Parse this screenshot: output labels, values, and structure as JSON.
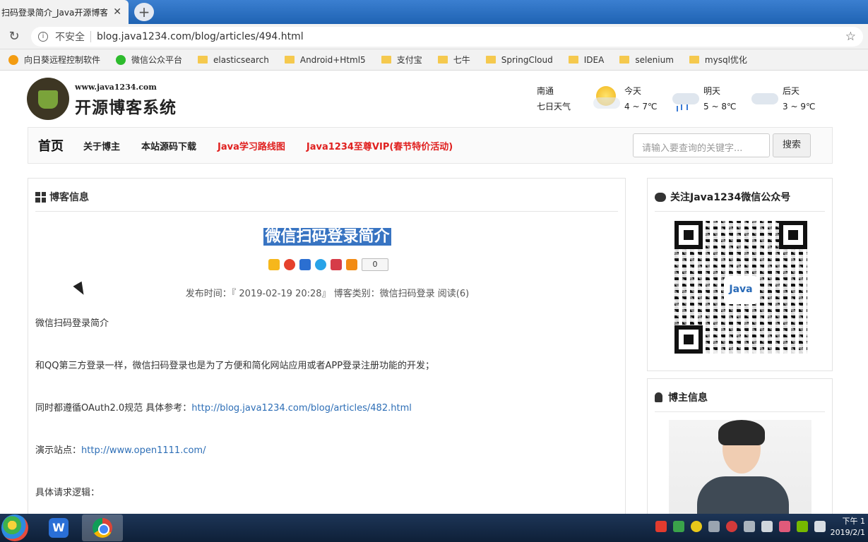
{
  "browser": {
    "tab_title": "扫码登录简介_Java开源博客",
    "tab_close": "✕",
    "new_tab": "+",
    "reload": "↻",
    "insecure_label": "不安全",
    "url": "blog.java1234.com/blog/articles/494.html",
    "star": "☆"
  },
  "bookmarks": [
    {
      "label": "向日葵远程控制软件",
      "icon": "sunflower-icon"
    },
    {
      "label": "微信公众平台",
      "icon": "wechat-icon"
    },
    {
      "label": "elasticsearch",
      "icon": "folder-icon"
    },
    {
      "label": "Android+Html5",
      "icon": "folder-icon"
    },
    {
      "label": "支付宝",
      "icon": "folder-icon"
    },
    {
      "label": "七牛",
      "icon": "folder-icon"
    },
    {
      "label": "SpringCloud",
      "icon": "folder-icon"
    },
    {
      "label": "IDEA",
      "icon": "folder-icon"
    },
    {
      "label": "selenium",
      "icon": "folder-icon"
    },
    {
      "label": "mysql优化",
      "icon": "folder-icon"
    }
  ],
  "site": {
    "logo_url": "www.java1234.com",
    "logo_name": "开源博客系统"
  },
  "weather": {
    "city": "南通",
    "subtitle": "七日天气",
    "days": [
      {
        "label": "今天",
        "temp": "4 ~ 7℃",
        "icon": "sunny-icon"
      },
      {
        "label": "明天",
        "temp": "5 ~ 8℃",
        "icon": "rain-icon"
      },
      {
        "label": "后天",
        "temp": "3 ~ 9℃",
        "icon": "cloudy-icon"
      }
    ]
  },
  "nav": {
    "home": "首页",
    "items": [
      "关于博主",
      "本站源码下载"
    ],
    "red_items": [
      "Java学习路线图",
      "Java1234至尊VIP(春节特价活动)"
    ],
    "search_placeholder": "请输入要查询的关键字...",
    "search_button": "搜索"
  },
  "article": {
    "panel_title": "博客信息",
    "title": "微信扫码登录简介",
    "share_count": "0",
    "meta": "发布时间：『 2019-02-19 20:28』  博客类别：微信扫码登录  阅读(6)",
    "p1": "微信扫码登录简介",
    "p2": "和QQ第三方登录一样，微信扫码登录也是为了方便和简化网站应用或者APP登录注册功能的开发；",
    "p3_text": "同时都遵循OAuth2.0规范 具体参考：",
    "p3_link": "http://blog.java1234.com/blog/articles/482.html",
    "p4_text": "演示站点：",
    "p4_link": "http://www.open1111.com/",
    "p5": "具体请求逻辑："
  },
  "sidebar": {
    "qr_title": "关注Java1234微信公众号",
    "qr_center": "Java",
    "author_title": "博主信息"
  },
  "taskbar": {
    "wps_label": "W",
    "clock_time": "下午 1",
    "clock_date": "2019/2/1"
  }
}
